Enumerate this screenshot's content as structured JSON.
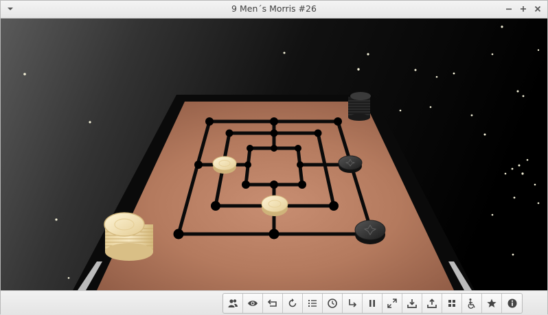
{
  "window": {
    "title": "9 Men´s Morris #26",
    "menu_icon": "chevron-down-icon",
    "minimize_icon": "minimize-icon",
    "maximize_icon": "maximize-icon",
    "close_icon": "close-icon"
  },
  "board": {
    "game": "Nine Men's Morris",
    "white_pieces_on_board": 2,
    "black_pieces_on_board": 2,
    "colors": {
      "board_wood": "#b07358",
      "frame": "#0c0c0c",
      "white_piece": "#f1dfb2",
      "black_piece": "#2e2e2e"
    }
  },
  "toolbar": {
    "buttons": [
      {
        "name": "players-icon"
      },
      {
        "name": "eye-icon"
      },
      {
        "name": "undo-icon"
      },
      {
        "name": "restart-icon"
      },
      {
        "name": "move-list-icon"
      },
      {
        "name": "clock-icon"
      },
      {
        "name": "redo-icon"
      },
      {
        "name": "pause-icon"
      },
      {
        "name": "fullscreen-icon"
      },
      {
        "name": "download-icon"
      },
      {
        "name": "upload-icon"
      },
      {
        "name": "grid-icon"
      },
      {
        "name": "accessibility-icon"
      },
      {
        "name": "star-icon"
      },
      {
        "name": "info-icon"
      }
    ]
  }
}
